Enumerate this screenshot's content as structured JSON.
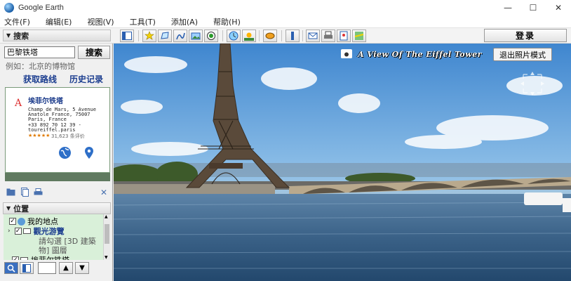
{
  "window": {
    "title": "Google Earth",
    "controls": {
      "minimize": "—",
      "maximize": "☐",
      "close": "✕"
    }
  },
  "menu": [
    "文件(F)",
    "编辑(E)",
    "视图(V)",
    "工具(T)",
    "添加(A)",
    "帮助(H)"
  ],
  "toolbar": {
    "login_label": "登录"
  },
  "search": {
    "header": "搜索",
    "input_value": "巴黎铁塔",
    "button_label": "搜索",
    "hint": "例如：北京的博物馆",
    "get_directions": "获取路线",
    "history": "历史记录"
  },
  "result": {
    "marker": "A",
    "name": "埃菲尔铁塔",
    "lines": [
      "Champ de Mars, 5 Avenue",
      "Anatole France, 75007",
      "Paris, France",
      "+33 892 70 12 39  -",
      "toureiffel.paris"
    ],
    "stars": "★★★★★",
    "review": "31,623 条评价"
  },
  "places": {
    "header": "位置",
    "items": [
      {
        "label": "我的地点",
        "checked": true
      },
      {
        "label": "觀光游覽",
        "checked": true
      },
      {
        "label": "請勾選 [3D 建築",
        "checked": false
      },
      {
        "label": "物] 圖層",
        "checked": false
      },
      {
        "label": "埃菲尔铁塔",
        "checked": true
      }
    ]
  },
  "viewer": {
    "tour_title": "A View Of The Eiffel Tower",
    "exit_label": "退出照片模式"
  },
  "colors": {
    "accent": "#1b3d8f",
    "places_bg": "#d9f0d9"
  }
}
